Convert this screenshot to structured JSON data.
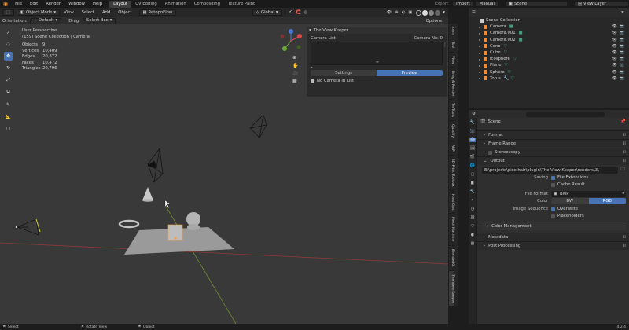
{
  "menu": {
    "file": "File",
    "edit": "Edit",
    "render": "Render",
    "window": "Window",
    "help": "Help",
    "workspaces": [
      {
        "label": "Layout",
        "active": true
      },
      {
        "label": "UV Editing",
        "active": false
      },
      {
        "label": "Animation",
        "active": false
      },
      {
        "label": "Compositing",
        "active": false
      },
      {
        "label": "Texture Paint",
        "active": false
      }
    ],
    "export": "Export",
    "import": "Import",
    "manual": "Manual",
    "scene": "Scene",
    "view_layer": "View Layer"
  },
  "header": {
    "mode": "Object Mode",
    "view": "View",
    "select": "Select",
    "add": "Add",
    "object": "Object",
    "retopoflow": "RetopoFlow",
    "orientation_label": "Orientation:",
    "orientation": "Default",
    "drag_label": "Drag:",
    "drag": "Select Box",
    "transform": "Global",
    "options": "Options"
  },
  "overlay": {
    "title": "User Perspective",
    "subtitle": "(159) Scene Collection | Camera",
    "stats": [
      {
        "key": "Objects",
        "value": "9"
      },
      {
        "key": "Vertices",
        "value": "10,409"
      },
      {
        "key": "Edges",
        "value": "20,872"
      },
      {
        "key": "Faces",
        "value": "10,472"
      },
      {
        "key": "Triangles",
        "value": "20,796"
      }
    ]
  },
  "view_keeper": {
    "title": "The View Keeper",
    "camera_list": "Camera List",
    "camera_no": "Camera No: 0",
    "settings_tab": "Settings",
    "preview_tab": "Preview",
    "no_camera": "No Camera in List"
  },
  "ntabs": [
    "Item",
    "Tool",
    "View",
    "Drag & Render",
    "TexTools",
    "Quadify",
    "ARP",
    "3D-Print Toolbox",
    "Hard Ops",
    "Mesh Machine",
    "BlenderKit",
    "The View Keeper"
  ],
  "outliner": {
    "collection": "Scene Collection",
    "items": [
      {
        "name": "Camera",
        "color": "#f28a3c"
      },
      {
        "name": "Camera.001",
        "color": "#f28a3c"
      },
      {
        "name": "Camera.002",
        "color": "#f28a3c"
      },
      {
        "name": "Cone",
        "color": "#f28a3c"
      },
      {
        "name": "Cube",
        "color": "#f28a3c"
      },
      {
        "name": "Icosphere",
        "color": "#f28a3c"
      },
      {
        "name": "Plane",
        "color": "#f28a3c"
      },
      {
        "name": "Sphere",
        "color": "#f28a3c"
      },
      {
        "name": "Torus",
        "color": "#f28a3c"
      }
    ]
  },
  "properties": {
    "scene_label": "Scene",
    "sections": {
      "format": "Format",
      "frame_range": "Frame Range",
      "stereoscopy": "Stereoscopy",
      "output": "Output",
      "color_management": "Color Management",
      "metadata": "Metadata",
      "post_processing": "Post Processing"
    },
    "output_path": "E:\\projects\\pixelhair\\plugin\\The View Keeper\\renders\\3\\",
    "saving_label": "Saving",
    "file_extensions": "File Extensions",
    "cache_result": "Cache Result",
    "file_format_label": "File Format",
    "file_format": "BMP",
    "color_label": "Color",
    "bw": "BW",
    "rgb": "RGB",
    "image_sequence_label": "Image Sequence",
    "overwrite": "Overwrite",
    "placeholders": "Placeholders"
  },
  "status": {
    "select": "Select",
    "rotate": "Rotate View",
    "object": "Object",
    "version": "4.2.4"
  },
  "colors": {
    "accent": "#4772b3",
    "grid_x": "#8c3b3b",
    "grid_y": "#6f8b2e",
    "object_orange": "#f28a3c",
    "camera_green": "#42a07d"
  }
}
